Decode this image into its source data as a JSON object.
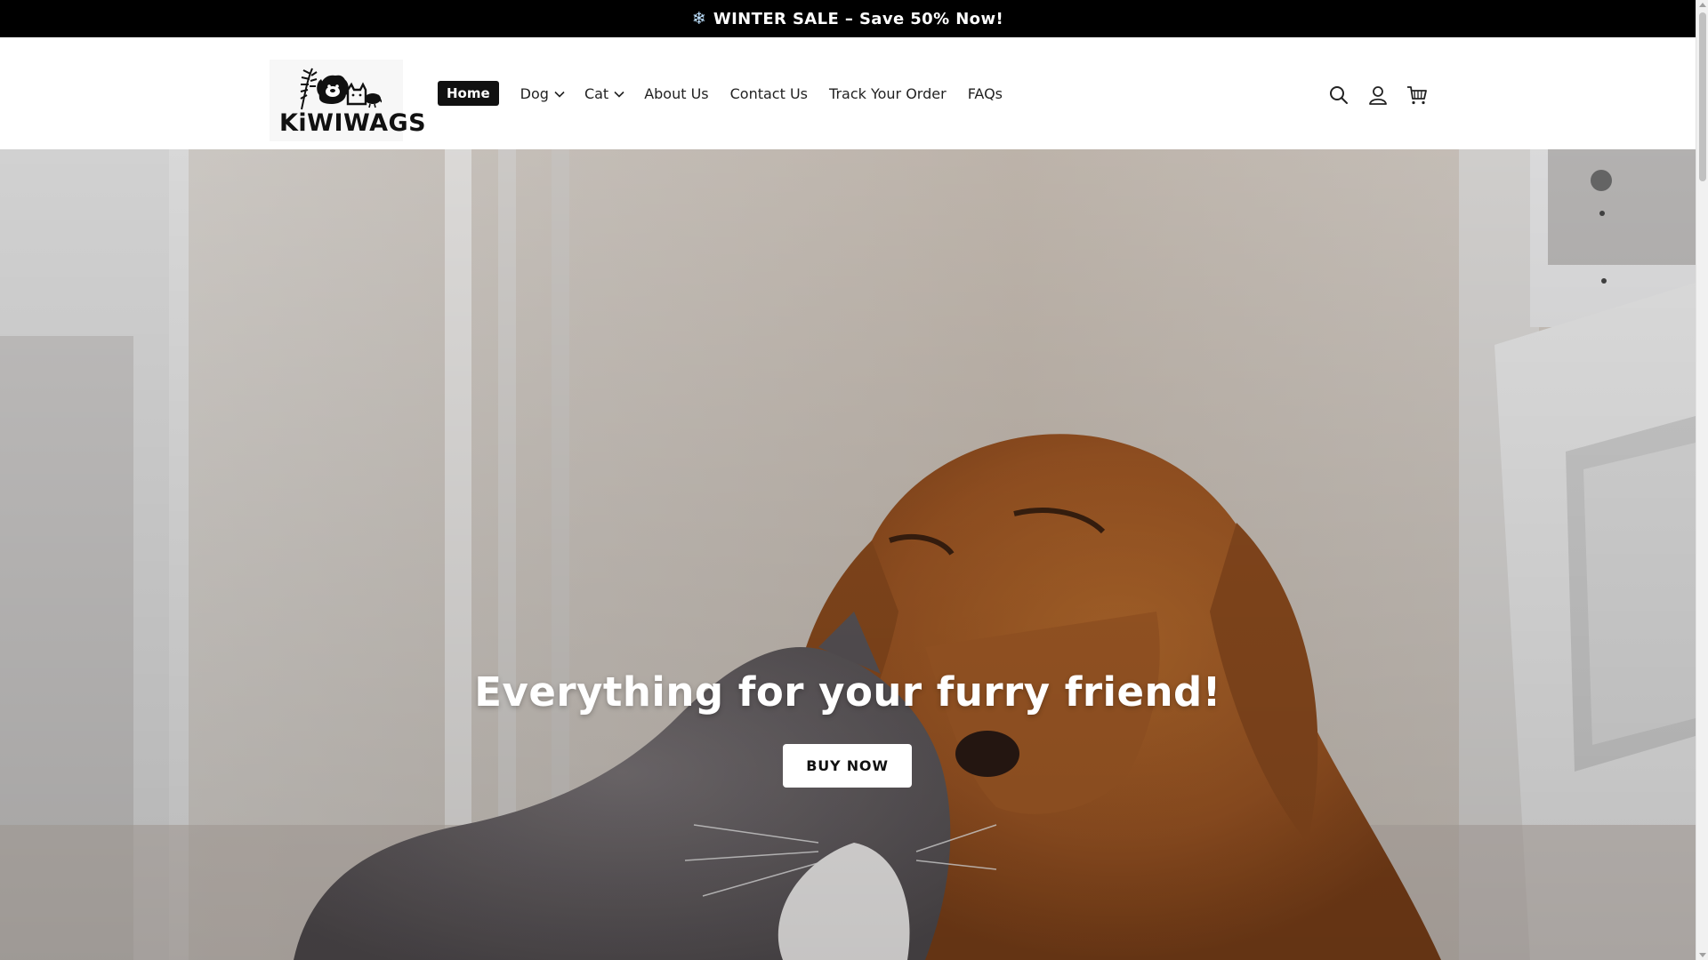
{
  "announcement": {
    "icon": "snowflake-icon",
    "snow_glyph": "❄",
    "text": "WINTER SALE – Save 50% Now!"
  },
  "header": {
    "logo_text": "KiWIWAGS",
    "nav": [
      {
        "label": "Home",
        "active": true
      },
      {
        "label": "Dog",
        "dropdown": true
      },
      {
        "label": "Cat",
        "dropdown": true
      },
      {
        "label": "About Us"
      },
      {
        "label": "Contact Us"
      },
      {
        "label": "Track Your Order"
      },
      {
        "label": "FAQs"
      }
    ],
    "icons": [
      "search-icon",
      "account-icon",
      "cart-icon"
    ]
  },
  "hero": {
    "title": "Everything for your furry friend!",
    "button_label": "BUY NOW"
  },
  "colors": {
    "announcement_bg": "#000000",
    "active_nav_bg": "#111111",
    "button_bg": "#ffffff"
  }
}
